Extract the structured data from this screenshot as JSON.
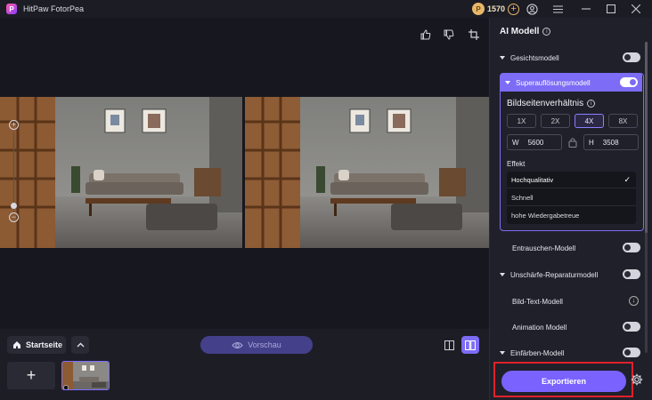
{
  "app": {
    "title": "HitPaw FotorPea",
    "logo_letter": "P",
    "credits": "1570"
  },
  "viewer": {
    "toolbar": {
      "like_icon": "thumbs-up-icon",
      "dislike_icon": "thumbs-down-icon",
      "crop_icon": "crop-icon"
    }
  },
  "bottom": {
    "home_label": "Startseite",
    "preview_label": "Vorschau",
    "add_label": "+"
  },
  "panel": {
    "title": "AI Modell",
    "models": {
      "face": "Gesichtsmodell",
      "super": "Superauflösungsmodell",
      "denoise": "Entrauschen-Modell",
      "blur": "Unschärfe-Reparaturmodell",
      "image_text": "Bild-Text-Modell",
      "animation": "Animation Modell",
      "colorize": "Einfärben-Modell"
    },
    "super_box": {
      "ratio_title": "Bildseitenverhältnis",
      "scales": [
        "1X",
        "2X",
        "4X",
        "8X"
      ],
      "active_scale": "4X",
      "width_key": "W",
      "width_value": "5600",
      "height_key": "H",
      "height_value": "3508",
      "effect_label": "Effekt",
      "effects": [
        "Hochqualitativ",
        "Schnell",
        "hohe Wiedergabetreue"
      ],
      "selected_effect": "Hochqualitativ"
    },
    "export_label": "Exportieren"
  },
  "colors": {
    "accent": "#7c6cf6",
    "export": "#7a62ff",
    "highlight_red": "#e0212b",
    "coin": "#e8b86a"
  }
}
